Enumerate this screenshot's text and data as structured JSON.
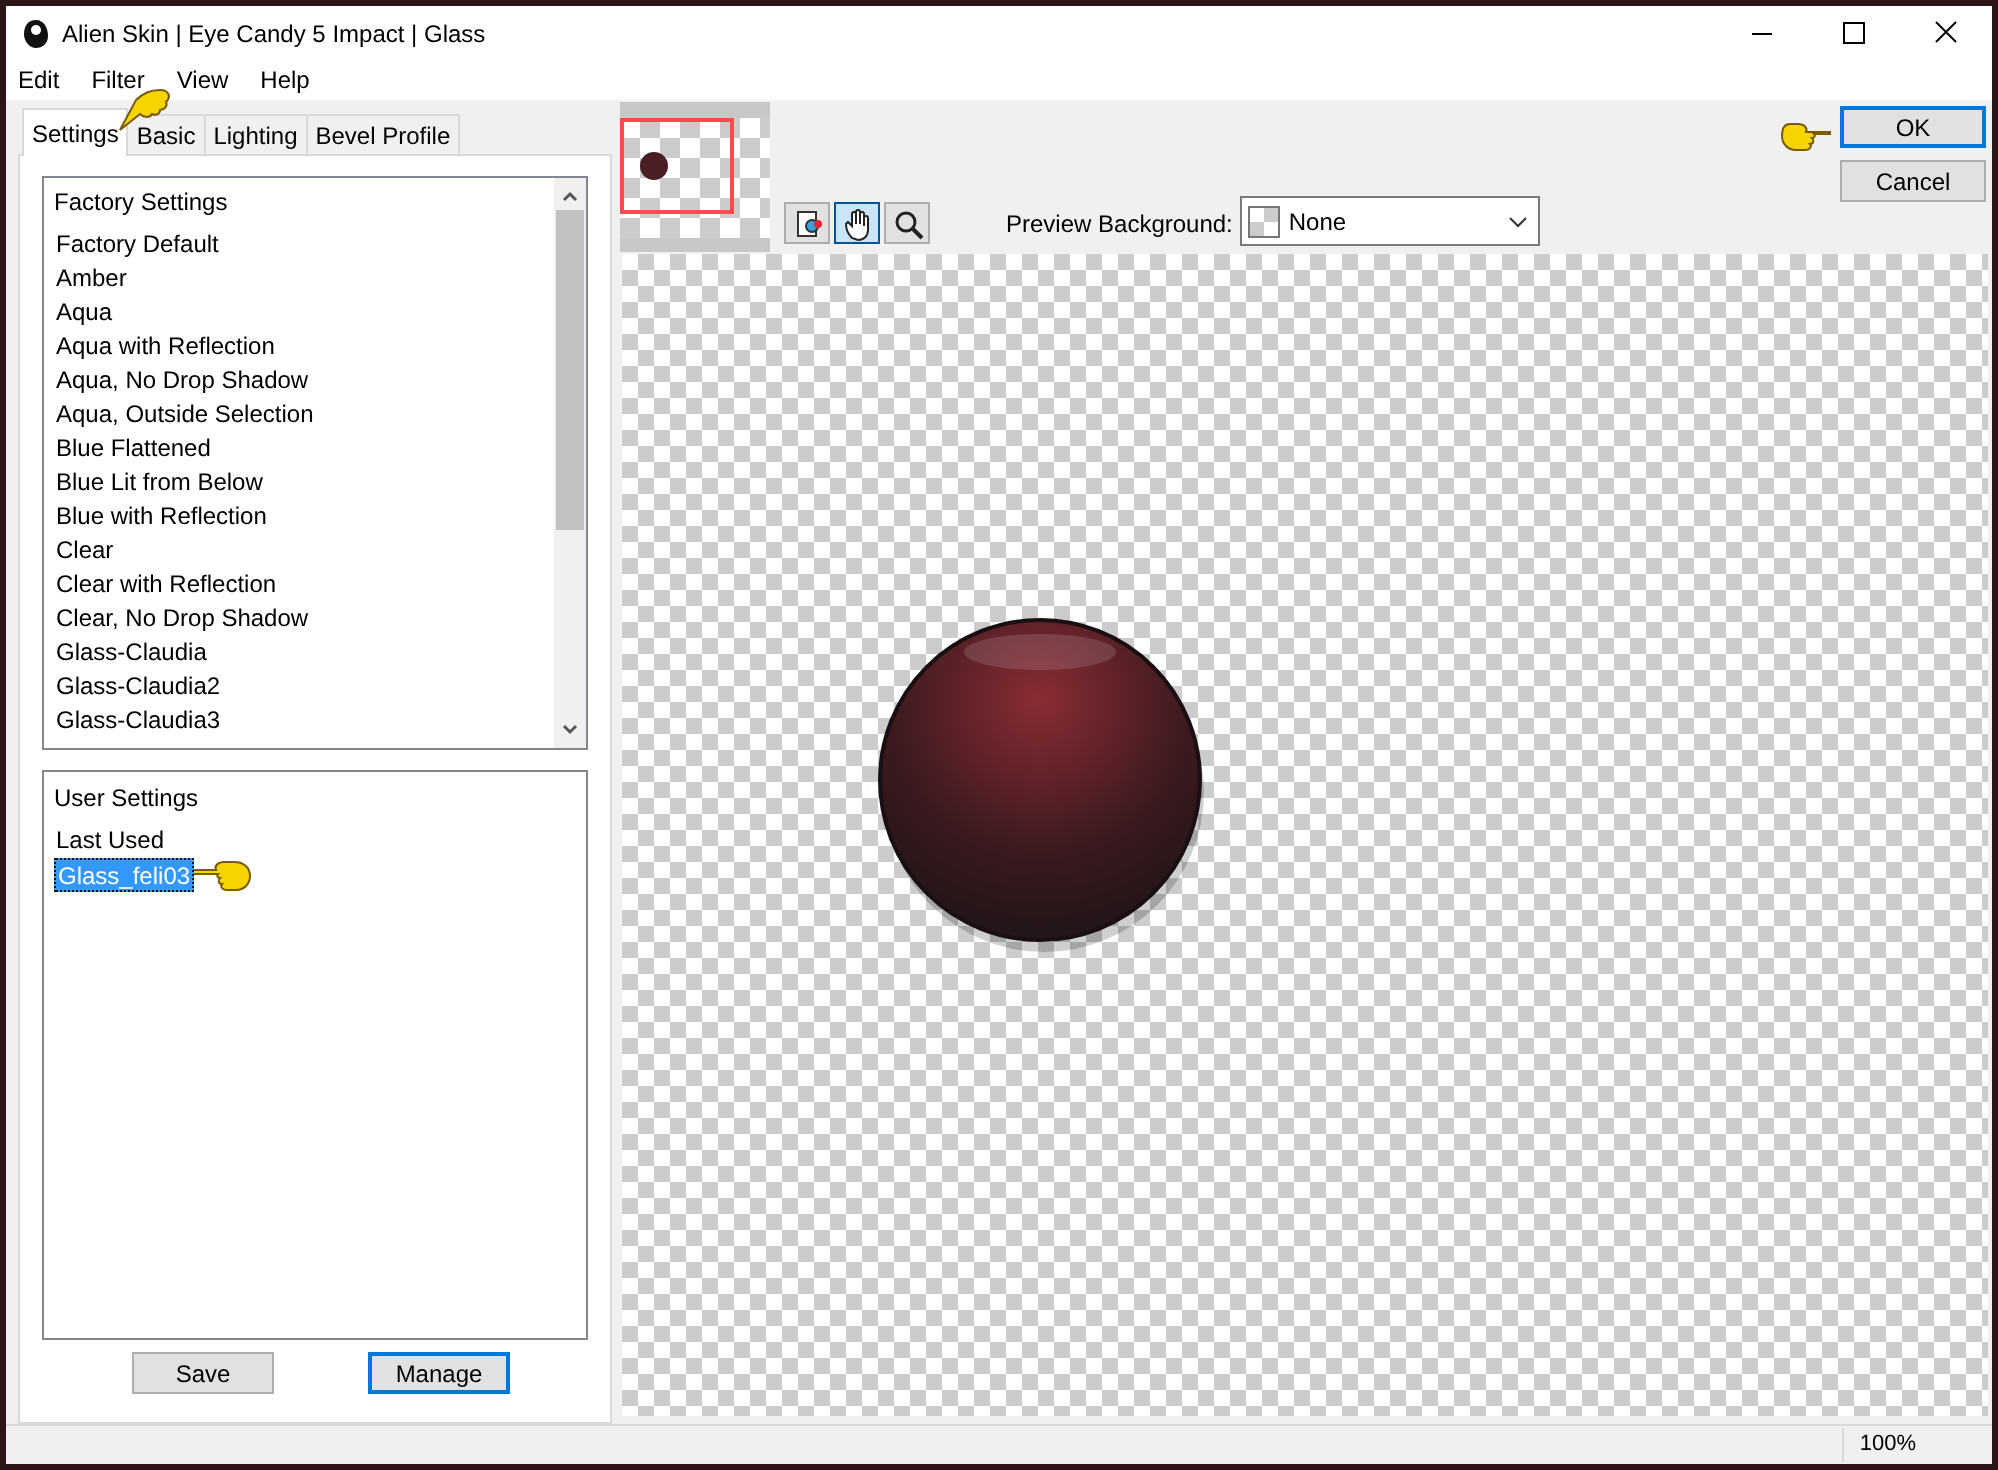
{
  "window": {
    "title": "Alien Skin | Eye Candy 5 Impact | Glass"
  },
  "menu": [
    "Edit",
    "Filter",
    "View",
    "Help"
  ],
  "tabs": [
    {
      "label": "Settings",
      "selected": true
    },
    {
      "label": "Basic",
      "selected": false
    },
    {
      "label": "Lighting",
      "selected": false
    },
    {
      "label": "Bevel Profile",
      "selected": false
    }
  ],
  "factory_settings": {
    "header": "Factory Settings",
    "items": [
      {
        "label": "Factory Default",
        "selected": false
      },
      {
        "label": "Amber",
        "selected": false
      },
      {
        "label": "Aqua",
        "selected": false
      },
      {
        "label": "Aqua with Reflection",
        "selected": false
      },
      {
        "label": "Aqua, No Drop Shadow",
        "selected": false
      },
      {
        "label": "Aqua, Outside Selection",
        "selected": false
      },
      {
        "label": "Blue Flattened",
        "selected": false
      },
      {
        "label": "Blue Lit from Below",
        "selected": false
      },
      {
        "label": "Blue with Reflection",
        "selected": false
      },
      {
        "label": "Clear",
        "selected": false
      },
      {
        "label": "Clear with Reflection",
        "selected": false
      },
      {
        "label": "Clear, No Drop Shadow",
        "selected": false
      },
      {
        "label": "Glass-Claudia",
        "selected": false
      },
      {
        "label": "Glass-Claudia2",
        "selected": false
      },
      {
        "label": "Glass-Claudia3",
        "selected": false
      }
    ]
  },
  "user_settings": {
    "header": "User Settings",
    "items": [
      {
        "label": "Last Used",
        "selected": false
      },
      {
        "label": "Glass_feli03",
        "selected": true
      }
    ]
  },
  "settings_buttons": [
    "Save",
    "Manage"
  ],
  "dialog_buttons": [
    "OK",
    "Cancel"
  ],
  "tools": [
    {
      "kind": "preview-toggle",
      "selected": false
    },
    {
      "kind": "hand",
      "selected": true
    },
    {
      "kind": "zoom",
      "selected": false
    }
  ],
  "preview_background": {
    "label": "Preview Background:",
    "value": "None"
  },
  "status_bar": {
    "zoom": "100%"
  }
}
